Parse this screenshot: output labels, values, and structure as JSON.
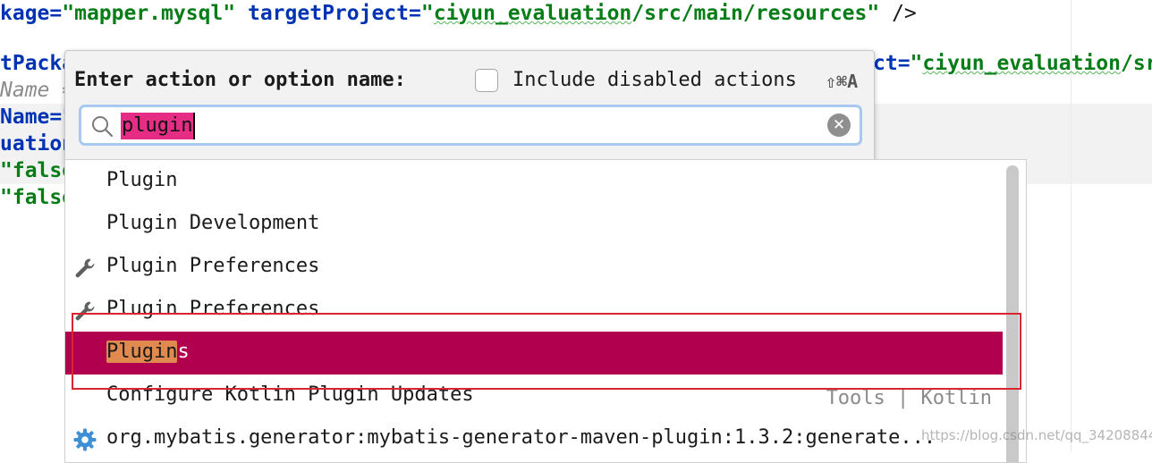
{
  "editor": {
    "line1": {
      "a1": "kage=",
      "s1": "\"mapper.mysql\"",
      "sp": " ",
      "a2": "targetProject=",
      "s2q1": "\"",
      "s2u": "ciyun_evaluation",
      "s2rest": "/src/main/resources\"",
      "end": " />"
    },
    "line2": {
      "left": "tPacka",
      "right_a": "ct=",
      "right_q": "\"",
      "right_u": "ciyun_evaluation",
      "right_rest": "/sr"
    },
    "line3": {
      "left": "Name ≈"
    },
    "line4": {
      "left": "Name=\""
    },
    "line5": {
      "left": "uation"
    },
    "line6": {
      "left": "\"false"
    },
    "line7": {
      "left": "\"false"
    }
  },
  "popup": {
    "title": "Enter action or option name:",
    "include_disabled_label": "Include disabled actions",
    "include_disabled_checked": false,
    "shortcut": "⇧⌘A",
    "search": {
      "value": "plugin"
    }
  },
  "results": [
    {
      "label": "Plugin",
      "icon": null,
      "hint": "",
      "selected": false
    },
    {
      "label": "Plugin Development",
      "icon": null,
      "hint": "",
      "selected": false
    },
    {
      "label": "Plugin Preferences",
      "icon": "wrench-icon",
      "hint": "",
      "selected": false
    },
    {
      "label": "Plugin Preferences",
      "icon": "wrench-icon",
      "hint": "",
      "selected": false
    },
    {
      "label_match": "Plugin",
      "label_rest": "s",
      "icon": null,
      "hint": "",
      "selected": true
    },
    {
      "label": "Configure Kotlin Plugin Updates",
      "icon": null,
      "hint": "Tools | Kotlin",
      "selected": false
    },
    {
      "label": "org.mybatis.generator:mybatis-generator-maven-plugin:1.3.2:generate...",
      "icon": "gear-icon",
      "hint": "",
      "selected": false
    }
  ],
  "watermark": "https://blog.csdn.net/qq_34208844",
  "colors": {
    "selection": "#b1004d",
    "search_highlight": "#e52d86",
    "match_highlight": "#e08a4f",
    "annotation_box": "#d9262f"
  }
}
